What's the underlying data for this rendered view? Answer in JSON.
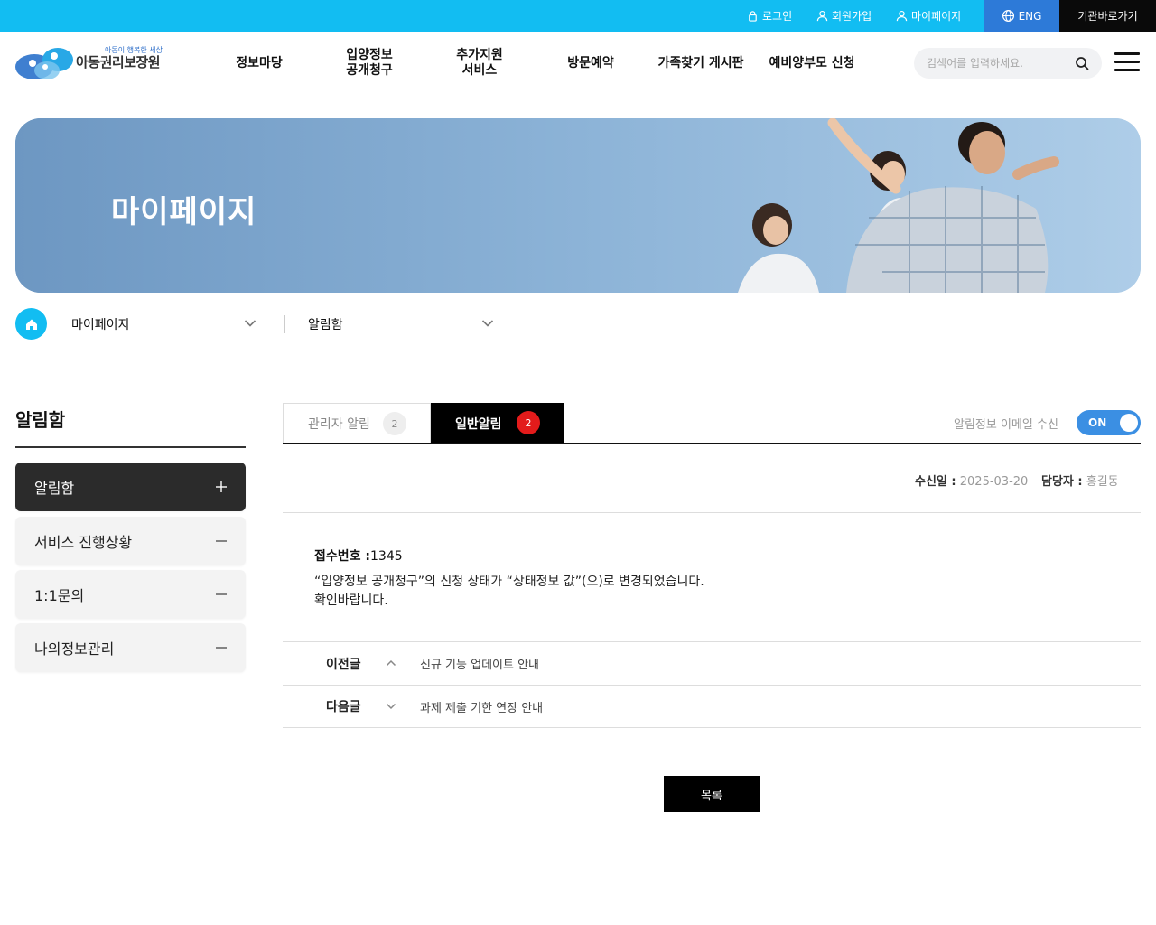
{
  "topbar": {
    "login": "로그인",
    "join": "회원가입",
    "mypage": "마이페이지",
    "eng": "ENG",
    "institutions": "기관바로가기"
  },
  "header": {
    "logo_tagline": "아동이 행복한 세상",
    "logo_name": "아동권리보장원",
    "nav": [
      "정보마당",
      "입양정보\n공개청구",
      "추가지원\n서비스",
      "방문예약",
      "가족찾기 게시판",
      "예비양부모 신청"
    ],
    "search_placeholder": "검색어를 입력하세요."
  },
  "banner": {
    "title": "마이페이지"
  },
  "breadcrumb": {
    "level1": "마이페이지",
    "level2": "알림함"
  },
  "sidebar": {
    "title": "알림함",
    "items": [
      {
        "label": "알림함",
        "active": true
      },
      {
        "label": "서비스 진행상황",
        "active": false
      },
      {
        "label": "1:1문의",
        "active": false
      },
      {
        "label": "나의정보관리",
        "active": false
      }
    ]
  },
  "tabs": {
    "admin_label": "관리자 알림",
    "admin_count": "2",
    "general_label": "일반알림",
    "general_count": "2"
  },
  "email_setting": {
    "label": "알림정보 이메일 수신",
    "state": "ON"
  },
  "detail": {
    "received_label": "수신일 :",
    "received_date": "2025-03-20",
    "manager_label": "담당자 :",
    "manager_name": "홍길동",
    "receipt_label": "접수번호 :",
    "receipt_number": "1345",
    "message_line1": "“입양정보 공개청구”의 신청 상태가 “상태정보 값”(으)로 변경되었습니다.",
    "message_line2": "확인바랍니다."
  },
  "post_nav": {
    "prev_label": "이전글",
    "prev_title": "신규 기능 업데이트 안내",
    "next_label": "다음글",
    "next_title": "과제 제출 기한 연장 안내"
  },
  "list_button": "목록",
  "colors": {
    "accent": "#12bdf2",
    "eng_bg": "#2d7ad8",
    "toggle": "#3b8fe3",
    "badge_red": "#e31b1b"
  }
}
